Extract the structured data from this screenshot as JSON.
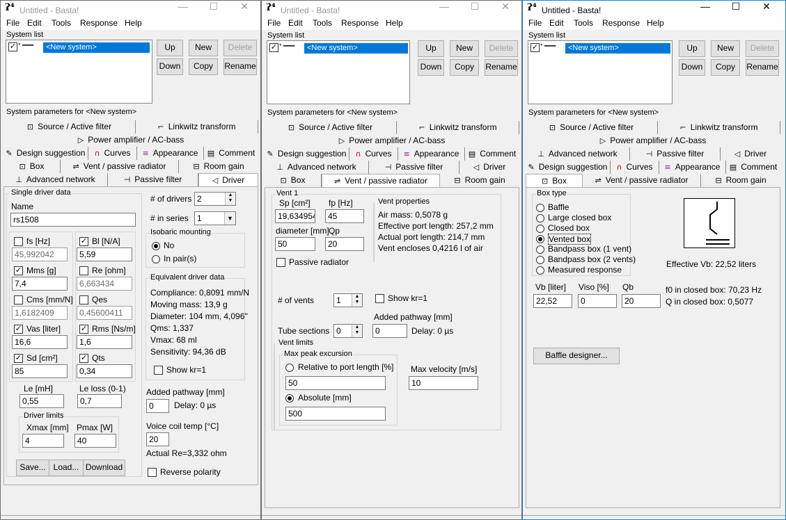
{
  "app_icon": "ʔ⁴",
  "windows": [
    {
      "title": "Untitled - Basta!"
    },
    {
      "title": "Untitled - Basta!"
    },
    {
      "title": "Untitled - Basta!"
    }
  ],
  "titlebar": {
    "minimize": "—",
    "maximize": "☐",
    "close": "✕"
  },
  "menu": [
    "File",
    "Edit",
    "Tools",
    "Response",
    "Help"
  ],
  "system_list": {
    "label": "System list",
    "item": "<New system>",
    "checked": "✓",
    "buttons": {
      "up": "Up",
      "new": "New",
      "delete": "Delete",
      "down": "Down",
      "copy": "Copy",
      "rename": "Rename"
    }
  },
  "params_label": "System parameters for <New system>",
  "tabs": {
    "source": "Source / Active filter",
    "linkwitz": "Linkwitz transform",
    "power": "Power amplifier / AC-bass",
    "design": "Design suggestion",
    "curves": "Curves",
    "appearance": "Appearance",
    "comment": "Comment",
    "box": "Box",
    "vent": "Vent / passive radiator",
    "room": "Room gain",
    "advanced": "Advanced network",
    "passive": "Passive filter",
    "driver": "Driver"
  },
  "tab_icons": {
    "source": "⊡",
    "linkwitz": "⌐",
    "power": "▷",
    "design": "✎",
    "curves": "∩",
    "appearance": "≡",
    "comment": "▤",
    "box": "⊡",
    "vent": "⇌",
    "room": "⊟",
    "advanced": "⊥",
    "passive": "⊣",
    "driver": "◁"
  },
  "driver": {
    "single_driver_label": "Single driver data",
    "name_label": "Name",
    "name": "rs1508",
    "params": [
      {
        "label": "fs [Hz]",
        "value": "45,992042",
        "checked": false
      },
      {
        "label": "Bl [N/A]",
        "value": "5,59",
        "checked": true
      },
      {
        "label": "Mms [g]",
        "value": "7,4",
        "checked": true
      },
      {
        "label": "Re [ohm]",
        "value": "6,663434",
        "checked": false
      },
      {
        "label": "Cms [mm/N]",
        "value": "1,6182409",
        "checked": false
      },
      {
        "label": "Qes",
        "value": "0,45600411",
        "checked": false
      },
      {
        "label": "Vas [liter]",
        "value": "16,6",
        "checked": true
      },
      {
        "label": "Rms [Ns/m]",
        "value": "1,6",
        "checked": true
      },
      {
        "label": "Sd [cm²]",
        "value": "85",
        "checked": true
      },
      {
        "label": "Qts",
        "value": "0,34",
        "checked": true
      }
    ],
    "le_label": "Le [mH]",
    "le": "0,55",
    "leloss_label": "Le loss (0-1)",
    "leloss": "0,7",
    "limits_label": "Driver limits",
    "xmax_label": "Xmax [mm]",
    "xmax": "4",
    "pmax_label": "Pmax [W]",
    "pmax": "40",
    "save": "Save...",
    "load": "Load...",
    "download": "Download",
    "num_drivers_label": "# of drivers",
    "num_drivers": "2",
    "in_series_label": "# in series",
    "in_series": "1",
    "isobaric_label": "Isobaric mounting",
    "iso_no": "No",
    "iso_pairs": "In pair(s)",
    "equiv_label": "Equivalent driver data",
    "equiv_lines": [
      "Compliance: 0,8091 mm/N",
      "Moving mass: 13,9 g",
      "Diameter: 104 mm, 4,096''",
      "Qms: 1,337",
      "Vmax: 68 ml",
      "Sensitivity: 94,36 dB"
    ],
    "show_kr": "Show kr=1",
    "pathway_label": "Added pathway [mm]",
    "pathway": "0",
    "delay": "Delay: 0 µs",
    "vctemp_label": "Voice coil temp [°C]",
    "vctemp": "20",
    "actual_re": "Actual Re=3,332 ohm",
    "reverse": "Reverse polarity"
  },
  "vent": {
    "vent1_label": "Vent 1",
    "sp_label": "Sp [cm²]",
    "sp": "19,6349540",
    "fp_label": "fp [Hz]",
    "fp": "45",
    "diam_label": "diameter [mm]",
    "diam": "50",
    "qp_label": "Qp",
    "qp": "20",
    "props_label": "Vent properties",
    "props": [
      "Air mass: 0,5078 g",
      "Effective port length: 257,2 mm",
      "Actual port length: 214,7 mm",
      "Vent encloses 0,4216 l of air"
    ],
    "passive_radiator": "Passive radiator",
    "num_vents_label": "# of vents",
    "num_vents": "1",
    "show_kr": "Show kr=1",
    "pathway_label": "Added pathway [mm]",
    "tube_label": "Tube sections",
    "tube": "0",
    "pathway": "0",
    "delay": "Delay: 0 µs",
    "limits_label": "Vent limits",
    "excursion_label": "Max peak excursion",
    "relative": "Relative to port length [%]",
    "relative_val": "50",
    "absolute": "Absolute [mm]",
    "absolute_val": "500",
    "maxvel_label": "Max velocity [m/s]",
    "maxvel": "10"
  },
  "box": {
    "type_label": "Box type",
    "types": [
      "Baffle",
      "Large closed box",
      "Closed box",
      "Vented box",
      "Bandpass box (1 vent)",
      "Bandpass box (2 vents)",
      "Measured response"
    ],
    "effective_vb": "Effective Vb: 22,52 liters",
    "vb_label": "Vb [liter]",
    "vb": "22,52",
    "viso_label": "Viso [%]",
    "viso": "0",
    "qb_label": "Qb",
    "qb": "20",
    "f0": "f0 in closed box: 70,23 Hz",
    "q": "Q  in closed box: 0,5077",
    "baffle_designer": "Baffle designer..."
  }
}
